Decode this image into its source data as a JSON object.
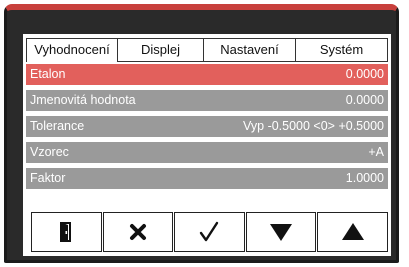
{
  "tabs": [
    {
      "label": "Vyhodnocení",
      "active": true
    },
    {
      "label": "Displej",
      "active": false
    },
    {
      "label": "Nastavení",
      "active": false
    },
    {
      "label": "Systém",
      "active": false
    }
  ],
  "rows": [
    {
      "label": "Etalon",
      "value": "0.0000",
      "selected": true
    },
    {
      "label": "Jmenovitá hodnota",
      "value": "0.0000",
      "selected": false
    },
    {
      "label": "Tolerance",
      "value": "Vyp -0.5000 <0> +0.5000",
      "selected": false
    },
    {
      "label": "Vzorec",
      "value": "+A",
      "selected": false
    },
    {
      "label": "Faktor",
      "value": "1.0000",
      "selected": false
    }
  ],
  "buttons": [
    {
      "icon": "exit-door-icon"
    },
    {
      "icon": "close-x-icon"
    },
    {
      "icon": "checkmark-icon"
    },
    {
      "icon": "arrow-down-icon"
    },
    {
      "icon": "arrow-up-icon"
    }
  ],
  "colors": {
    "accent": "#c8403c",
    "selected_row": "#e2605c",
    "row": "#9a9a9a",
    "frame": "#2a2a2a"
  }
}
